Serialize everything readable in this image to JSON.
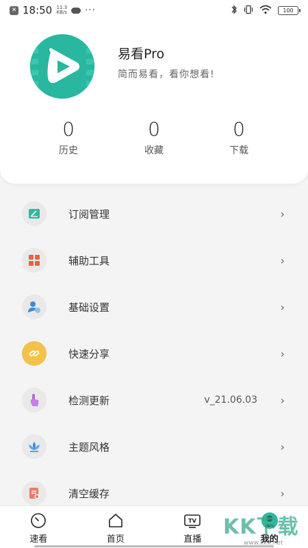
{
  "status_bar": {
    "time": "18:50",
    "net_speed_top": "11.3",
    "net_speed_bottom": "KB/s",
    "dots": "···",
    "battery": "100"
  },
  "profile": {
    "app_name": "易看Pro",
    "slogan": "简而易看，看你想看!",
    "logo_icon": "play-logo-icon",
    "brand_color": "#29b7a0"
  },
  "stats": [
    {
      "value": "0",
      "label": "历史"
    },
    {
      "value": "0",
      "label": "收藏"
    },
    {
      "value": "0",
      "label": "下载"
    }
  ],
  "menu": [
    {
      "label": "订阅管理",
      "icon": "subscribe-icon",
      "value": ""
    },
    {
      "label": "辅助工具",
      "icon": "tools-grid-icon",
      "value": ""
    },
    {
      "label": "基础设置",
      "icon": "user-settings-icon",
      "value": ""
    },
    {
      "label": "快速分享",
      "icon": "link-share-icon",
      "value": ""
    },
    {
      "label": "检测更新",
      "icon": "update-hand-icon",
      "value": "v_21.06.03"
    },
    {
      "label": "主题风格",
      "icon": "theme-lotus-icon",
      "value": ""
    },
    {
      "label": "清空缓存",
      "icon": "clear-cache-icon",
      "value": ""
    }
  ],
  "tabs": [
    {
      "label": "速看",
      "icon": "clock-icon"
    },
    {
      "label": "首页",
      "icon": "home-icon"
    },
    {
      "label": "直播",
      "icon": "tv-icon"
    },
    {
      "label": "我的",
      "icon": "profile-icon",
      "active": true
    }
  ],
  "watermark": {
    "text": "KK下载",
    "url": "www.kkx.net"
  }
}
